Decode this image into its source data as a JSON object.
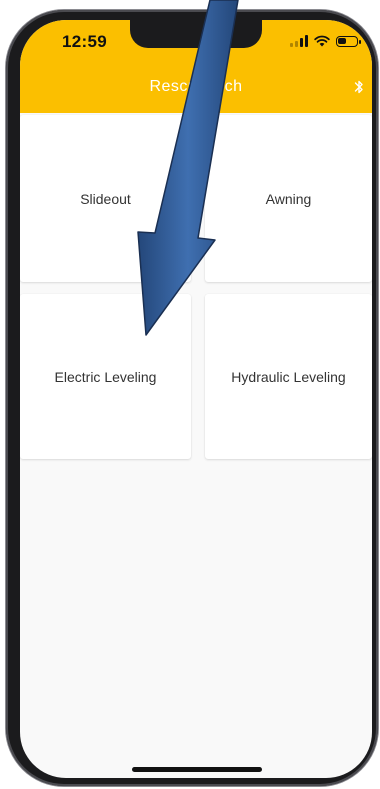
{
  "status_bar": {
    "time": "12:59",
    "icons": [
      "signal-icon",
      "wifi-icon",
      "battery-icon"
    ]
  },
  "header": {
    "title": "RescueTech",
    "bluetooth_icon": "bluetooth-icon",
    "background": "#fbbf00",
    "text_color": "#ffffff"
  },
  "tiles": [
    {
      "label": "Slideout"
    },
    {
      "label": "Awning"
    },
    {
      "label": "Electric Leveling"
    },
    {
      "label": "Hydraulic Leveling"
    }
  ],
  "annotation": {
    "arrow_icon": "arrow-pointer-icon",
    "arrow_color": "#2e5a93"
  }
}
